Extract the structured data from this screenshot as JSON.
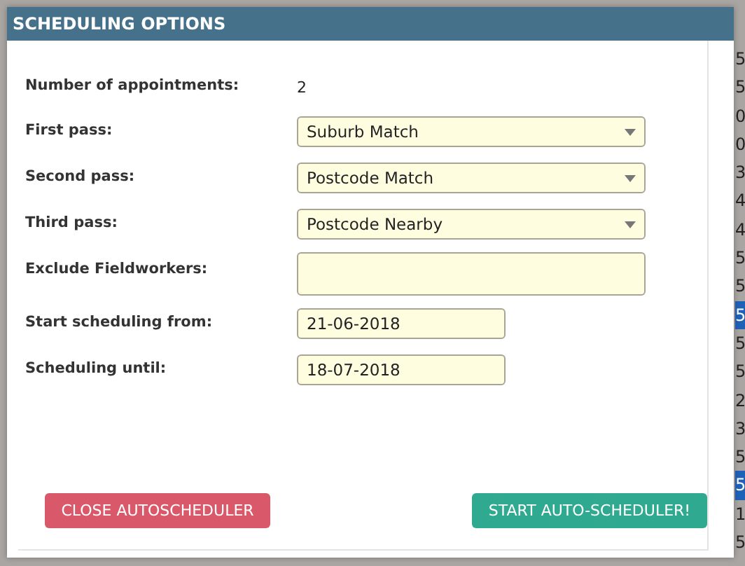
{
  "background_table": {
    "edge_cells": [
      {
        "text": "5",
        "selected": false
      },
      {
        "text": "5",
        "selected": false
      },
      {
        "text": "0",
        "selected": false
      },
      {
        "text": "0",
        "selected": false
      },
      {
        "text": "3",
        "selected": false
      },
      {
        "text": "4",
        "selected": false
      },
      {
        "text": "4",
        "selected": false
      },
      {
        "text": "5",
        "selected": false
      },
      {
        "text": "5",
        "selected": false
      },
      {
        "text": "5",
        "selected": true
      },
      {
        "text": "5",
        "selected": false
      },
      {
        "text": "5",
        "selected": false
      },
      {
        "text": "2",
        "selected": false
      },
      {
        "text": "3",
        "selected": false
      },
      {
        "text": "5",
        "selected": false
      },
      {
        "text": "5",
        "selected": true
      },
      {
        "text": "1",
        "selected": false
      },
      {
        "text": "5",
        "selected": false
      }
    ]
  },
  "dialog": {
    "title": "SCHEDULING OPTIONS",
    "fields": [
      {
        "kind": "text",
        "label": "Number of appointments:",
        "value": "2"
      },
      {
        "kind": "select",
        "label": "First pass:",
        "value": "Suburb Match"
      },
      {
        "kind": "select",
        "label": "Second pass:",
        "value": "Postcode Match"
      },
      {
        "kind": "select",
        "label": "Third pass:",
        "value": "Postcode Nearby"
      },
      {
        "kind": "multi",
        "label": "Exclude Fieldworkers:"
      },
      {
        "kind": "date",
        "label": "Start scheduling from:",
        "value": "21-06-2018"
      },
      {
        "kind": "date",
        "label": "Scheduling until:",
        "value": "18-07-2018"
      }
    ],
    "buttons": [
      {
        "label": "CLOSE AUTOSCHEDULER",
        "kind": "danger"
      },
      {
        "label": "START AUTO-SCHEDULER!",
        "kind": "success"
      }
    ]
  }
}
